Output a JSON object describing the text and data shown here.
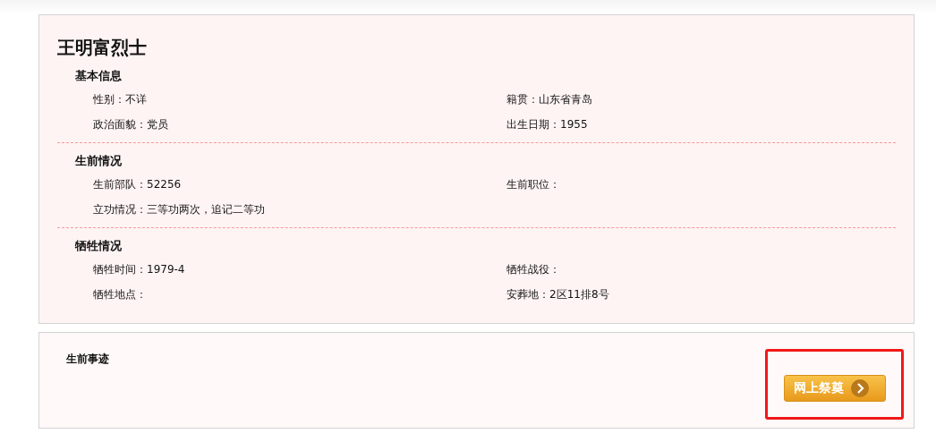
{
  "title": "王明富烈士",
  "sections": [
    {
      "heading": "基本信息",
      "fields": [
        "性别：不详",
        "籍贯：山东省青岛",
        "政治面貌：党员",
        "出生日期：1955"
      ]
    },
    {
      "heading": "生前情况",
      "fields": [
        "生前部队：52256",
        "生前职位：",
        "立功情况：三等功两次，追记二等功"
      ]
    },
    {
      "heading": "牺牲情况",
      "fields": [
        "牺牲时间：1979-4",
        "牺牲战役：",
        "牺牲地点：",
        "安葬地：2区11排8号"
      ]
    }
  ],
  "deeds": {
    "heading": "生前事迹",
    "button": "网上祭奠"
  }
}
